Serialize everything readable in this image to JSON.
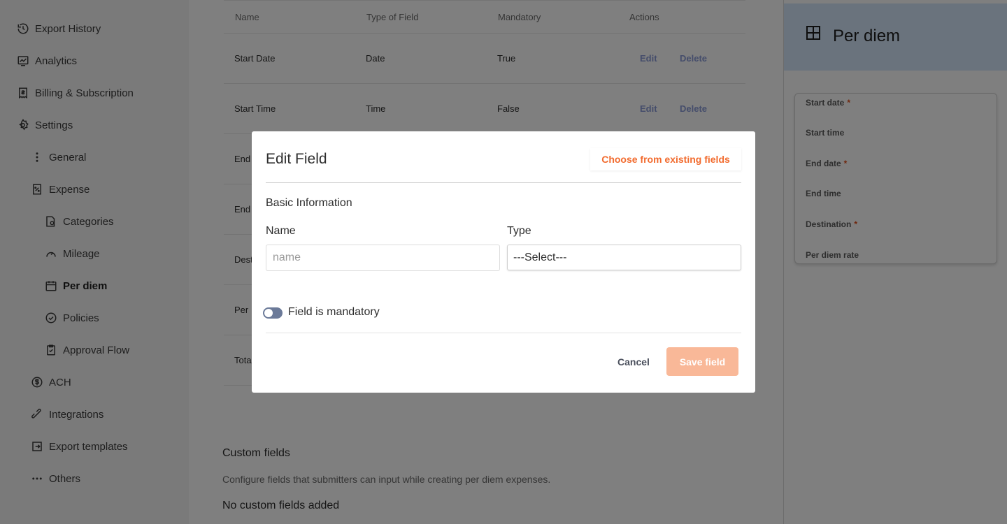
{
  "sidebar": {
    "items": [
      {
        "label": "Export History",
        "icon": "history-icon"
      },
      {
        "label": "Analytics",
        "icon": "analytics-icon"
      },
      {
        "label": "Billing & Subscription",
        "icon": "billing-icon"
      },
      {
        "label": "Settings",
        "icon": "gear-icon"
      },
      {
        "label": "General",
        "icon": "vertical-dots-icon"
      },
      {
        "label": "Expense",
        "icon": "receipt-icon"
      },
      {
        "label": "Categories",
        "icon": "categories-icon"
      },
      {
        "label": "Mileage",
        "icon": "gauge-icon"
      },
      {
        "label": "Per diem",
        "icon": "calendar-icon"
      },
      {
        "label": "Policies",
        "icon": "check-circle-icon"
      },
      {
        "label": "Approval Flow",
        "icon": "clipboard-check-icon"
      },
      {
        "label": "ACH",
        "icon": "dollar-circle-icon"
      },
      {
        "label": "Integrations",
        "icon": "integrations-icon"
      },
      {
        "label": "Export templates",
        "icon": "export-icon"
      },
      {
        "label": "Others",
        "icon": "horizontal-dots-icon"
      }
    ]
  },
  "table": {
    "headers": {
      "name": "Name",
      "type": "Type of Field",
      "mandatory": "Mandatory",
      "actions": "Actions"
    },
    "rows": [
      {
        "name": "Start Date",
        "type": "Date",
        "mandatory": "True",
        "edit": "Edit",
        "delete": "Delete"
      },
      {
        "name": "Start Time",
        "type": "Time",
        "mandatory": "False",
        "edit": "Edit",
        "delete": "Delete"
      },
      {
        "name": "End"
      },
      {
        "name": "End"
      },
      {
        "name": "Dest"
      },
      {
        "name": "Per"
      },
      {
        "name": "Tota"
      }
    ]
  },
  "custom_fields": {
    "title": "Custom fields",
    "description": "Configure fields that submitters can input while creating per diem expenses.",
    "empty": "No custom fields added"
  },
  "preview": {
    "title": "Per diem",
    "fields": [
      {
        "label": "Start date",
        "required": "*"
      },
      {
        "label": "Start time",
        "required": ""
      },
      {
        "label": "End date",
        "required": "*"
      },
      {
        "label": "End time",
        "required": ""
      },
      {
        "label": "Destination",
        "required": "*"
      },
      {
        "label": "Per diem rate",
        "required": ""
      }
    ]
  },
  "modal": {
    "title": "Edit Field",
    "choose_existing": "Choose from existing fields",
    "section": "Basic Information",
    "name_label": "Name",
    "name_placeholder": "name",
    "type_label": "Type",
    "type_value": "---Select---",
    "mandatory_label": "Field is mandatory",
    "mandatory_on": false,
    "cancel": "Cancel",
    "save": "Save field"
  },
  "colors": {
    "accent": "#f26b2e",
    "save_disabled": "#f9b898",
    "link": "#8a9ad6",
    "preview_header": "#d4e6fb",
    "required": "#e04e1b"
  }
}
